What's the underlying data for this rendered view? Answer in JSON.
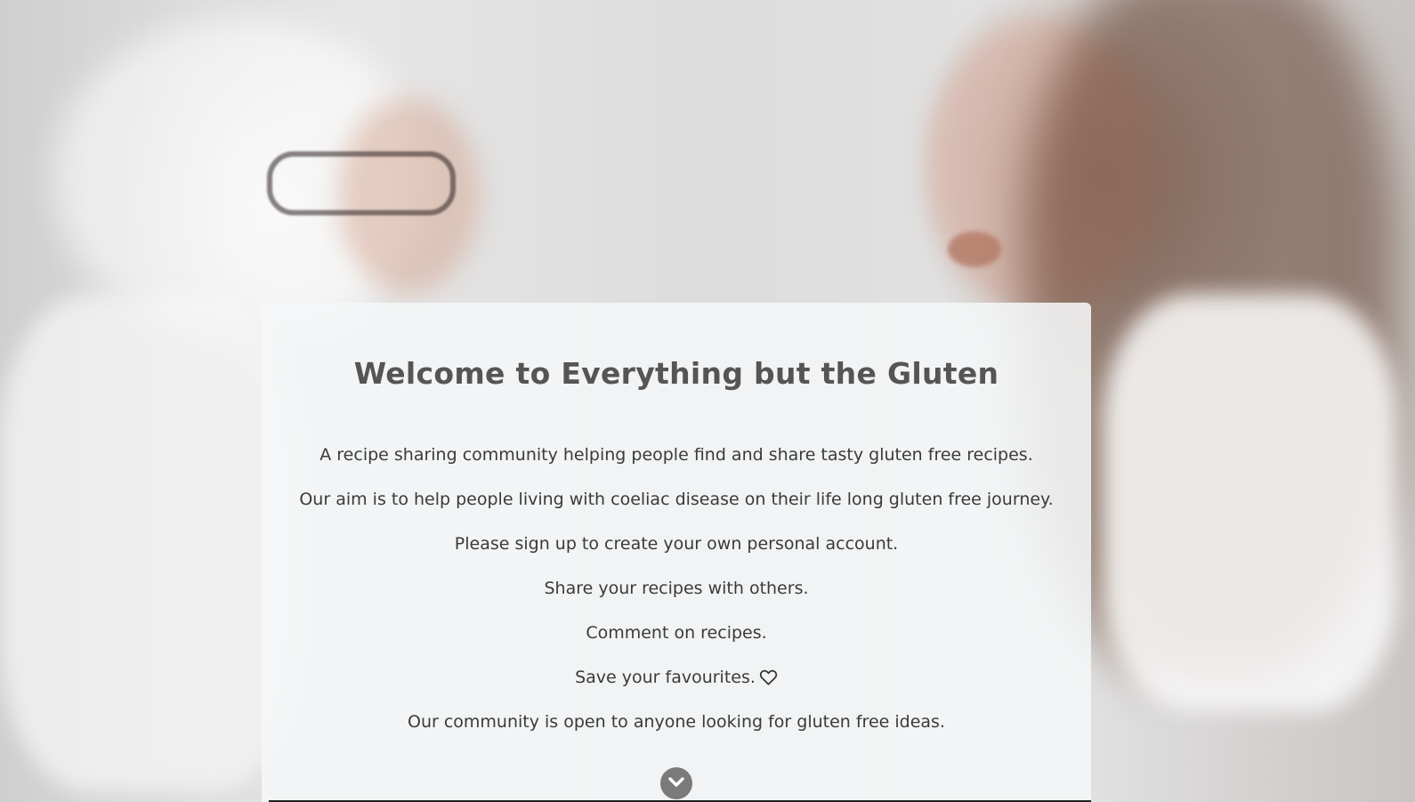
{
  "hero": {
    "title": "Welcome to Everything but the Gluten",
    "lines": [
      "A recipe sharing community helping people find and share tasty gluten free recipes.",
      "Our aim is to help people living with coeliac disease on their life long gluten free journey.",
      "Please sign up to create your own personal account.",
      "Share your recipes with others.",
      "Comment on recipes.",
      "Save your favourites.",
      "Our community is open to anyone looking for gluten free ideas."
    ],
    "favourites_icon": "heart-outline-icon",
    "scroll_icon": "chevron-down-circle-icon"
  },
  "colors": {
    "card_background": "#f4f6f7",
    "title": "#555555",
    "body_text": "#3a3a3a",
    "chevron": "#7a7a7a"
  }
}
